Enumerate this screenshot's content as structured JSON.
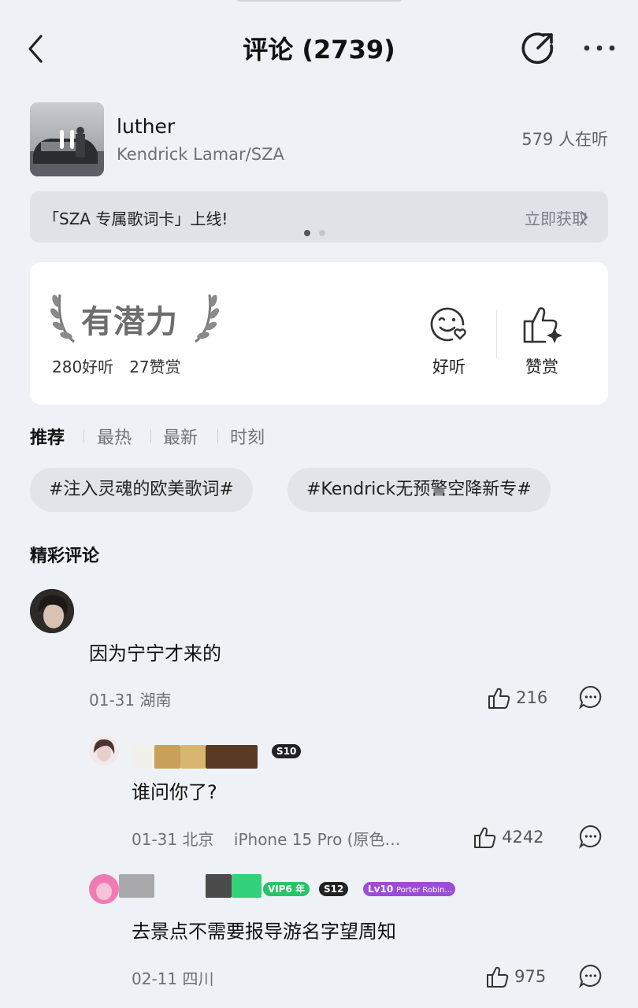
{
  "header": {
    "title": "评论 (2739)",
    "back_icon": "chevron-left-icon",
    "share_icon": "share-icon",
    "more_icon": "more-horizontal-icon"
  },
  "song": {
    "title": "luther",
    "artist": "Kendrick Lamar/SZA",
    "listeners": "579 人在听",
    "cover_icon": "pause-icon"
  },
  "banner": {
    "text": "「SZA 专属歌词卡」上线!",
    "link": "立即获取",
    "page_index": 1,
    "page_count": 2
  },
  "potential": {
    "badge": "有潜力",
    "listens": "280好听",
    "tips": "27赞赏",
    "good_label": "好听",
    "tip_label": "赞赏"
  },
  "tabs": [
    {
      "label": "推荐",
      "active": true
    },
    {
      "label": "最热",
      "active": false
    },
    {
      "label": "最新",
      "active": false
    },
    {
      "label": "时刻",
      "active": false
    }
  ],
  "tags": [
    "#注入灵魂的欧美歌词#",
    "#Kendrick无预警空降新专#"
  ],
  "section_title": "精彩评论",
  "comments": [
    {
      "text": "因为宁宁才来的",
      "meta": "01-31 湖南",
      "likes": "216"
    },
    {
      "text": "谁问你了?",
      "meta": "01-31 北京    iPhone 15 Pro (原色…",
      "likes": "4242",
      "badges": [
        "S10"
      ]
    },
    {
      "text": "去景点不需要报导游名字望周知",
      "meta": "02-11 四川",
      "likes": "975",
      "badges": [
        "VIP6 年",
        "S12",
        "Lv10",
        "Porter Robin…"
      ]
    }
  ],
  "colors": {
    "background": "#eef1f5",
    "card": "#ffffff",
    "vip_green": "#29c36a",
    "level_purple": "#9b4dd6"
  }
}
